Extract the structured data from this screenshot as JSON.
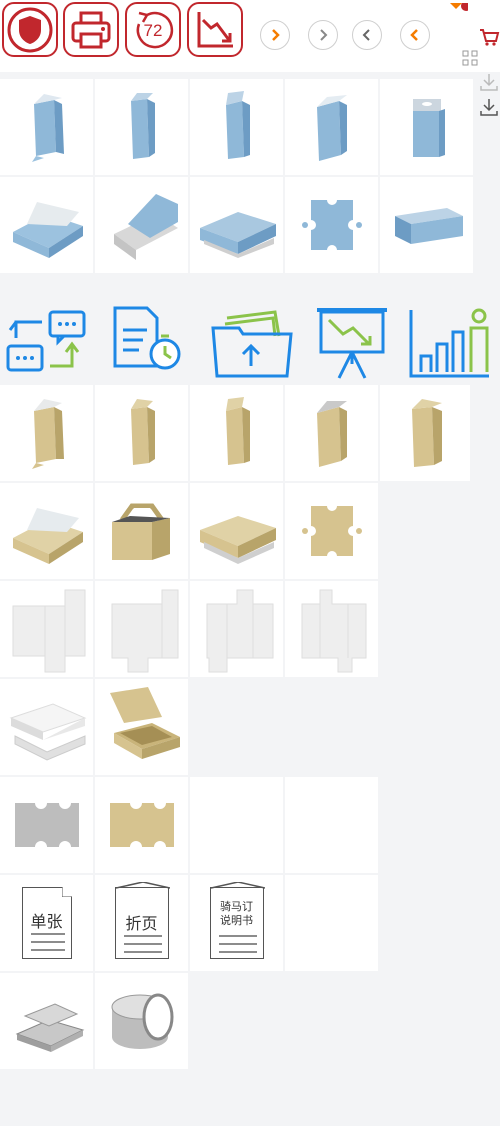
{
  "toolbar": {
    "buttons": [
      {
        "name": "shield-button",
        "icon": "shield-icon"
      },
      {
        "name": "printer-button",
        "icon": "printer-icon"
      },
      {
        "name": "72-hour-button",
        "icon": "clock-arrow-icon",
        "label": "72"
      },
      {
        "name": "chart-down-button",
        "icon": "chart-down-icon"
      }
    ],
    "nav": [
      "chevron-right-orange",
      "chevron-right-gray",
      "chevron-left-gray",
      "chevron-left-orange"
    ]
  },
  "side": {
    "icons": [
      "cart-icon",
      "qr-icon",
      "download-icon",
      "download-icon"
    ]
  },
  "colors": {
    "accent": "#c1272d",
    "blue_box": "#8fb8d8",
    "kraft_box": "#d6c38f",
    "icon_blue": "#1e88e5",
    "icon_green": "#8bc34a",
    "orange": "#f57c00"
  },
  "docs": {
    "single": "单张",
    "fold": "折页",
    "saddle_1": "骑马订",
    "saddle_2": "说明书"
  }
}
